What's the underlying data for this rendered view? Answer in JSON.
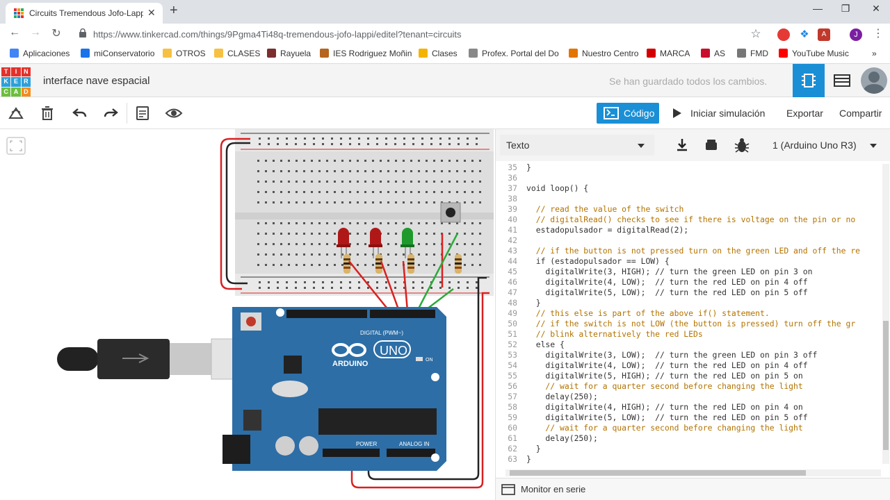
{
  "browser": {
    "tab_title": "Circuits Tremendous Jofo-Lappi |",
    "url": "https://www.tinkercad.com/things/9Pgma4Ti48q-tremendous-jofo-lappi/editel?tenant=circuits",
    "profile_initial": "J",
    "bookmarks": [
      {
        "label": "Aplicaciones",
        "icon": "apps-grid-icon",
        "color": "#4285f4"
      },
      {
        "label": "miConservatorio",
        "icon": "c-logo-icon",
        "color": "#1a73e8"
      },
      {
        "label": "OTROS",
        "icon": "folder-icon",
        "color": "#f6c142"
      },
      {
        "label": "CLASES",
        "icon": "folder-icon",
        "color": "#f6c142"
      },
      {
        "label": "Rayuela",
        "icon": "rayuela-icon",
        "color": "#7a2e2e"
      },
      {
        "label": "IES Rodriguez Moñin",
        "icon": "school-icon",
        "color": "#b5651d"
      },
      {
        "label": "Clases",
        "icon": "classroom-icon",
        "color": "#f4b400"
      },
      {
        "label": "Profex. Portal del Do",
        "icon": "star-icon",
        "color": "#888888"
      },
      {
        "label": "Nuestro Centro",
        "icon": "centro-icon",
        "color": "#e37400"
      },
      {
        "label": "MARCA",
        "icon": "marca-icon",
        "color": "#d40000"
      },
      {
        "label": "AS",
        "icon": "as-icon",
        "color": "#c8102e"
      },
      {
        "label": "FMD",
        "icon": "page-icon",
        "color": "#777777"
      },
      {
        "label": "YouTube Music",
        "icon": "youtube-music-icon",
        "color": "#ff0000"
      }
    ]
  },
  "tinkercad": {
    "logo_letters": [
      "T",
      "I",
      "N",
      "K",
      "E",
      "R",
      "C",
      "A",
      "D"
    ],
    "design_name": "interface nave espacial",
    "save_status": "Se han guardado todos los cambios.",
    "buttons": {
      "code": "Código",
      "simulate": "Iniciar simulación",
      "export": "Exportar",
      "share": "Compartir"
    }
  },
  "code_panel": {
    "mode": "Texto",
    "board": "1 (Arduino Uno R3)",
    "serial_monitor": "Monitor en serie",
    "lines": [
      {
        "n": "35",
        "t": "}",
        "k": "code"
      },
      {
        "n": "36",
        "t": "",
        "k": "code"
      },
      {
        "n": "37",
        "t": "void loop() {",
        "k": "code"
      },
      {
        "n": "38",
        "t": "",
        "k": "code"
      },
      {
        "n": "39",
        "t": "  // read the value of the switch",
        "k": "comment"
      },
      {
        "n": "40",
        "t": "  // digitalRead() checks to see if there is voltage on the pin or no",
        "k": "comment"
      },
      {
        "n": "41",
        "t": "  estadopulsador = digitalRead(2);",
        "k": "code"
      },
      {
        "n": "42",
        "t": "",
        "k": "code"
      },
      {
        "n": "43",
        "t": "  // if the button is not pressed turn on the green LED and off the re",
        "k": "comment"
      },
      {
        "n": "44",
        "t": "  if (estadopulsador == LOW) {",
        "k": "code"
      },
      {
        "n": "45",
        "t": "    digitalWrite(3, HIGH); // turn the green LED on pin 3 on",
        "k": "code"
      },
      {
        "n": "46",
        "t": "    digitalWrite(4, LOW);  // turn the red LED on pin 4 off",
        "k": "code"
      },
      {
        "n": "47",
        "t": "    digitalWrite(5, LOW);  // turn the red LED on pin 5 off",
        "k": "code"
      },
      {
        "n": "48",
        "t": "  }",
        "k": "code"
      },
      {
        "n": "49",
        "t": "  // this else is part of the above if() statement.",
        "k": "comment"
      },
      {
        "n": "50",
        "t": "  // if the switch is not LOW (the button is pressed) turn off the gr",
        "k": "comment"
      },
      {
        "n": "51",
        "t": "  // blink alternatively the red LEDs",
        "k": "comment"
      },
      {
        "n": "52",
        "t": "  else {",
        "k": "code"
      },
      {
        "n": "53",
        "t": "    digitalWrite(3, LOW);  // turn the green LED on pin 3 off",
        "k": "code"
      },
      {
        "n": "54",
        "t": "    digitalWrite(4, LOW);  // turn the red LED on pin 4 off",
        "k": "code"
      },
      {
        "n": "55",
        "t": "    digitalWrite(5, HIGH); // turn the red LED on pin 5 on",
        "k": "code"
      },
      {
        "n": "56",
        "t": "    // wait for a quarter second before changing the light",
        "k": "comment"
      },
      {
        "n": "57",
        "t": "    delay(250);",
        "k": "code"
      },
      {
        "n": "58",
        "t": "    digitalWrite(4, HIGH); // turn the red LED on pin 4 on",
        "k": "code"
      },
      {
        "n": "59",
        "t": "    digitalWrite(5, LOW);  // turn the red LED on pin 5 off",
        "k": "code"
      },
      {
        "n": "60",
        "t": "    // wait for a quarter second before changing the light",
        "k": "comment"
      },
      {
        "n": "61",
        "t": "    delay(250);",
        "k": "code"
      },
      {
        "n": "62",
        "t": "  }",
        "k": "code"
      },
      {
        "n": "63",
        "t": "}",
        "k": "code"
      }
    ]
  },
  "board_labels": {
    "brand": "ARDUINO",
    "model": "UNO",
    "digital": "DIGITAL (PWM~)",
    "power": "POWER",
    "analog": "ANALOG IN",
    "on": "ON"
  },
  "colors": {
    "accent_blue": "#1a8fd6",
    "board_blue": "#2d6ea6",
    "led_red": "#b01818",
    "led_green": "#1e9a2c",
    "wire_red": "#d92020",
    "wire_green": "#2caa3a",
    "comment": "#b37300"
  }
}
